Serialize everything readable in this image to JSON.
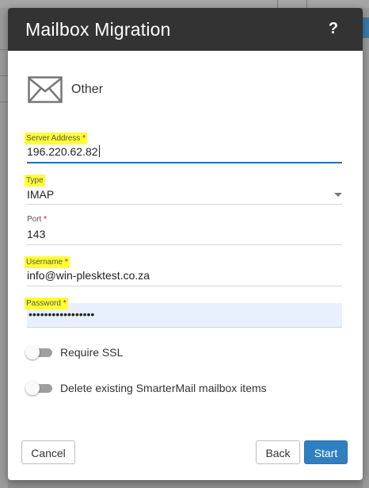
{
  "dialog": {
    "title": "Mailbox Migration",
    "help_label": "?",
    "provider": {
      "icon": "envelope-icon",
      "label": "Other"
    }
  },
  "fields": {
    "server_address": {
      "label": "Server Address",
      "required": "*",
      "value": "196.220.62.82"
    },
    "type": {
      "label": "Type",
      "value": "IMAP"
    },
    "port": {
      "label": "Port",
      "required": "*",
      "value": "143"
    },
    "username": {
      "label": "Username",
      "required": "*",
      "value": "info@win-plesktest.co.za"
    },
    "password": {
      "label": "Password",
      "required": "*",
      "value": "•••••••••••••••••"
    }
  },
  "toggles": {
    "require_ssl": {
      "label": "Require SSL",
      "checked": false
    },
    "delete_existing": {
      "label": "Delete existing SmarterMail mailbox items",
      "checked": false
    }
  },
  "buttons": {
    "cancel": "Cancel",
    "back": "Back",
    "start": "Start"
  },
  "colors": {
    "header": "#333333",
    "primary": "#2f80c0",
    "highlight": "#ffff33",
    "focus_line": "#2a6ea6"
  }
}
